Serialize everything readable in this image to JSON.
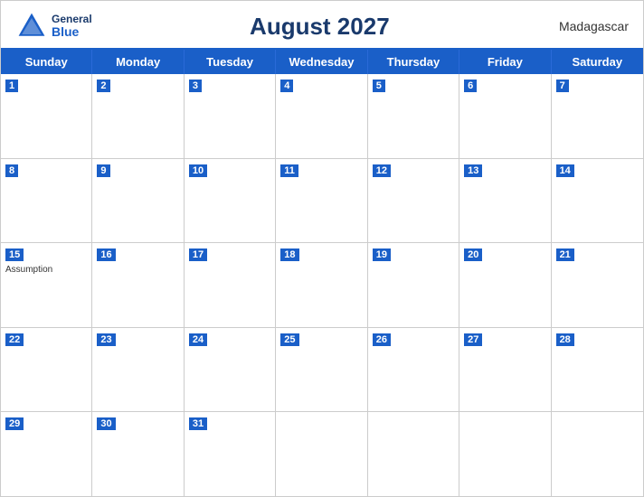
{
  "header": {
    "title": "August 2027",
    "country": "Madagascar",
    "logo": {
      "general": "General",
      "blue": "Blue"
    }
  },
  "days_of_week": [
    "Sunday",
    "Monday",
    "Tuesday",
    "Wednesday",
    "Thursday",
    "Friday",
    "Saturday"
  ],
  "weeks": [
    [
      {
        "day": 1,
        "holiday": ""
      },
      {
        "day": 2,
        "holiday": ""
      },
      {
        "day": 3,
        "holiday": ""
      },
      {
        "day": 4,
        "holiday": ""
      },
      {
        "day": 5,
        "holiday": ""
      },
      {
        "day": 6,
        "holiday": ""
      },
      {
        "day": 7,
        "holiday": ""
      }
    ],
    [
      {
        "day": 8,
        "holiday": ""
      },
      {
        "day": 9,
        "holiday": ""
      },
      {
        "day": 10,
        "holiday": ""
      },
      {
        "day": 11,
        "holiday": ""
      },
      {
        "day": 12,
        "holiday": ""
      },
      {
        "day": 13,
        "holiday": ""
      },
      {
        "day": 14,
        "holiday": ""
      }
    ],
    [
      {
        "day": 15,
        "holiday": "Assumption"
      },
      {
        "day": 16,
        "holiday": ""
      },
      {
        "day": 17,
        "holiday": ""
      },
      {
        "day": 18,
        "holiday": ""
      },
      {
        "day": 19,
        "holiday": ""
      },
      {
        "day": 20,
        "holiday": ""
      },
      {
        "day": 21,
        "holiday": ""
      }
    ],
    [
      {
        "day": 22,
        "holiday": ""
      },
      {
        "day": 23,
        "holiday": ""
      },
      {
        "day": 24,
        "holiday": ""
      },
      {
        "day": 25,
        "holiday": ""
      },
      {
        "day": 26,
        "holiday": ""
      },
      {
        "day": 27,
        "holiday": ""
      },
      {
        "day": 28,
        "holiday": ""
      }
    ],
    [
      {
        "day": 29,
        "holiday": ""
      },
      {
        "day": 30,
        "holiday": ""
      },
      {
        "day": 31,
        "holiday": ""
      },
      {
        "day": null,
        "holiday": ""
      },
      {
        "day": null,
        "holiday": ""
      },
      {
        "day": null,
        "holiday": ""
      },
      {
        "day": null,
        "holiday": ""
      }
    ]
  ],
  "colors": {
    "header_bg": "#1a5fc8",
    "header_text": "#ffffff",
    "title_color": "#1a3a6c",
    "border": "#cccccc"
  }
}
